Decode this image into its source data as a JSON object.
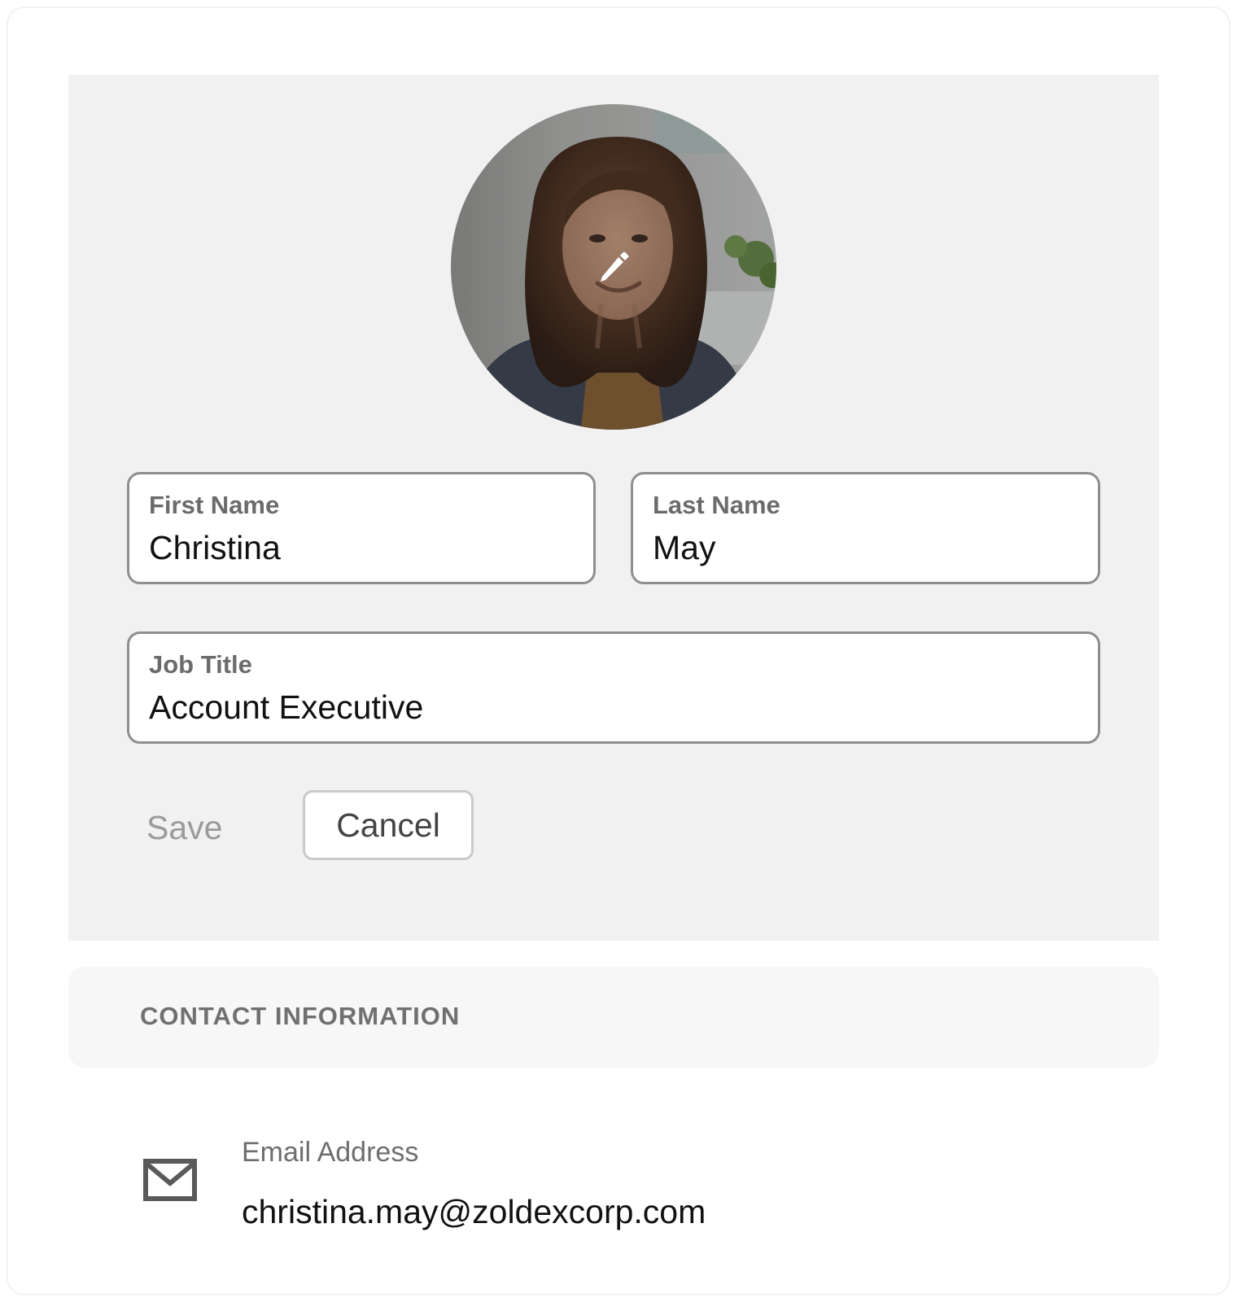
{
  "profile": {
    "avatar_alt": "Profile photo",
    "edit_icon": "pencil-icon"
  },
  "form": {
    "first_name": {
      "label": "First Name",
      "value": "Christina"
    },
    "last_name": {
      "label": "Last Name",
      "value": "May"
    },
    "job_title": {
      "label": "Job Title",
      "value": "Account Executive"
    },
    "save_label": "Save",
    "cancel_label": "Cancel"
  },
  "contact": {
    "section_title": "CONTACT INFORMATION",
    "email_label": "Email Address",
    "email_value": "christina.may@zoldexcorp.com",
    "email_icon": "envelope-icon"
  },
  "colors": {
    "panel_background": "#f1f1f1",
    "field_border": "#8e8e8e",
    "disabled_text": "#9a9a9a"
  }
}
